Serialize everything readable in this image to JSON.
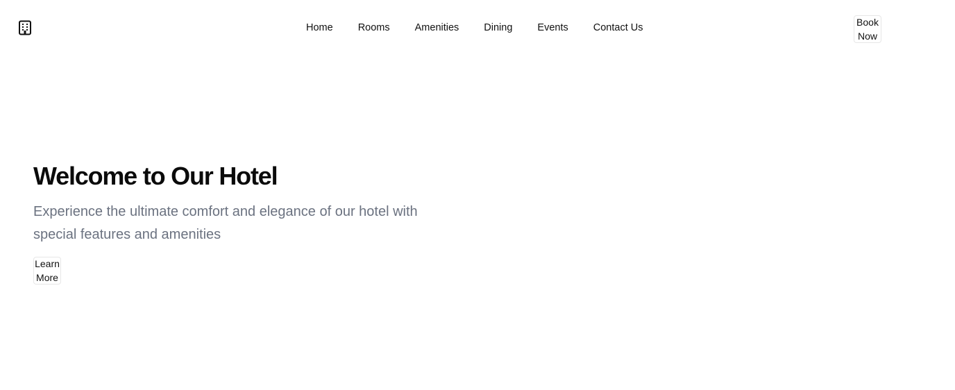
{
  "header": {
    "logo_icon": "building-icon",
    "nav": [
      {
        "label": "Home"
      },
      {
        "label": "Rooms"
      },
      {
        "label": "Amenities"
      },
      {
        "label": "Dining"
      },
      {
        "label": "Events"
      },
      {
        "label": "Contact Us"
      }
    ],
    "book_label": "Book Now"
  },
  "hero": {
    "title": "Welcome to Our Hotel",
    "subtitle": "Experience the ultimate comfort and elegance of our hotel with special features and amenities",
    "cta_label": "Learn More"
  },
  "colors": {
    "text": "#111111",
    "muted": "#6b7280",
    "border": "#e6e6e6",
    "background": "#ffffff"
  }
}
